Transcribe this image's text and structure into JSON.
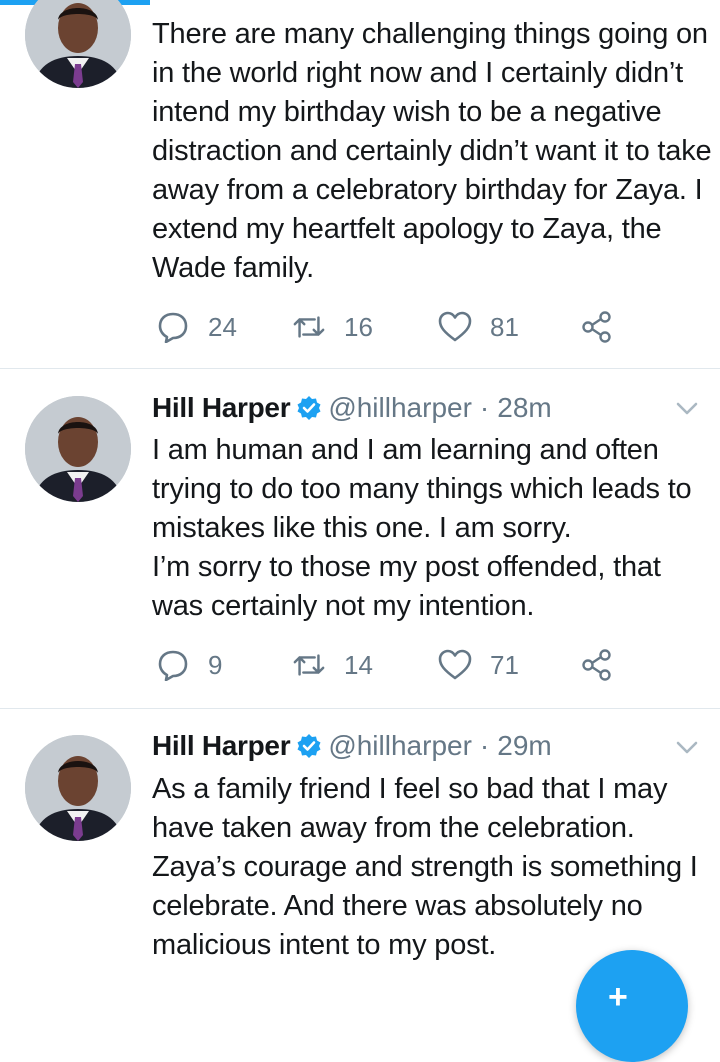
{
  "tweets": [
    {
      "name": "",
      "handle": "",
      "time": "",
      "paragraphs": [
        "There are many challenging things going on in the world right now and I certainly didn’t intend my birthday wish to be a negative distraction and certainly didn’t want it to take away from a celebratory birthday for Zaya. I extend my heartfelt apology to Zaya, the Wade family."
      ],
      "replies": "24",
      "retweets": "16",
      "likes": "81"
    },
    {
      "name": "Hill Harper",
      "handle": "@hillharper",
      "time": "28m",
      "paragraphs": [
        "I am human and I am learning and often trying to do too many things which leads to mistakes like this one. I am sorry.",
        "I’m sorry to those my post offended, that was certainly not my intention."
      ],
      "replies": "9",
      "retweets": "14",
      "likes": "71"
    },
    {
      "name": "Hill Harper",
      "handle": "@hillharper",
      "time": "29m",
      "paragraphs": [
        "As a family friend I feel so bad that I may have taken away from the celebration. Zaya’s courage and strength is something I celebrate. And there was absolutely no malicious intent to my post."
      ]
    }
  ],
  "separator": "·",
  "compose_button": {
    "label": "+"
  },
  "icons": {
    "reply": "reply-icon",
    "retweet": "retweet-icon",
    "like": "like-icon",
    "share": "share-icon",
    "verified": "verified-badge-icon",
    "more": "chevron-down-icon",
    "compose": "compose-tweet-icon"
  },
  "colors": {
    "accent": "#1da1f2",
    "text": "#14171a",
    "muted": "#657786",
    "divider": "#e1e8ed"
  }
}
